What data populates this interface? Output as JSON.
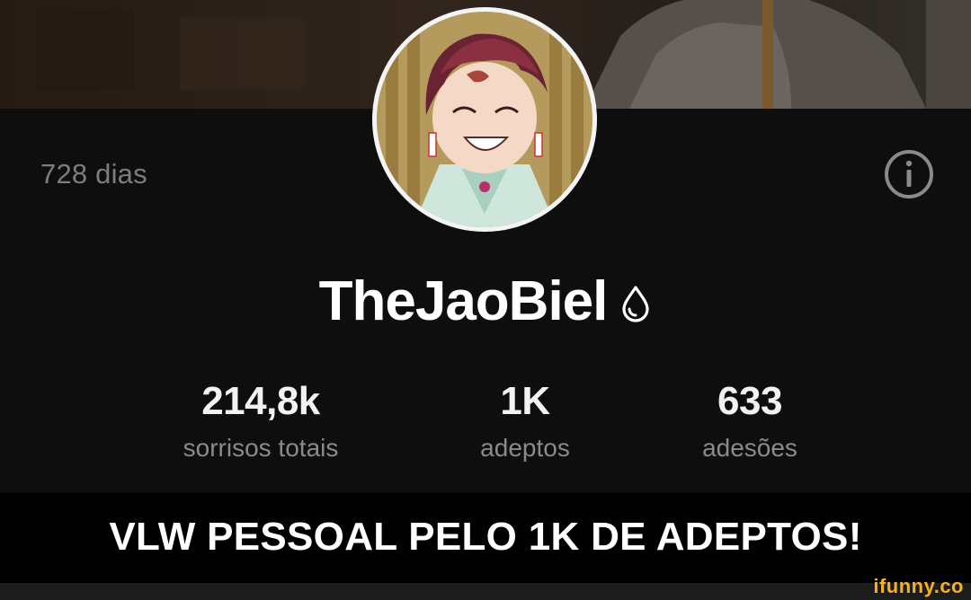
{
  "profile": {
    "days": "728 dias",
    "username": "TheJaoBiel",
    "badge_icon": "drop-icon",
    "info_icon": "info-icon",
    "avatar_alt": "avatar"
  },
  "stats": [
    {
      "value": "214,8k",
      "label": "sorrisos totais"
    },
    {
      "value": "1K",
      "label": "adeptos"
    },
    {
      "value": "633",
      "label": "adesões"
    }
  ],
  "caption": "VLW PESSOAL PELO 1K DE ADEPTOS!",
  "watermark": "ifunny.co",
  "colors": {
    "background": "#0e0e0e",
    "caption_bar": "#000000",
    "muted_text": "#8a8a8a",
    "watermark": "#f6b21a"
  }
}
